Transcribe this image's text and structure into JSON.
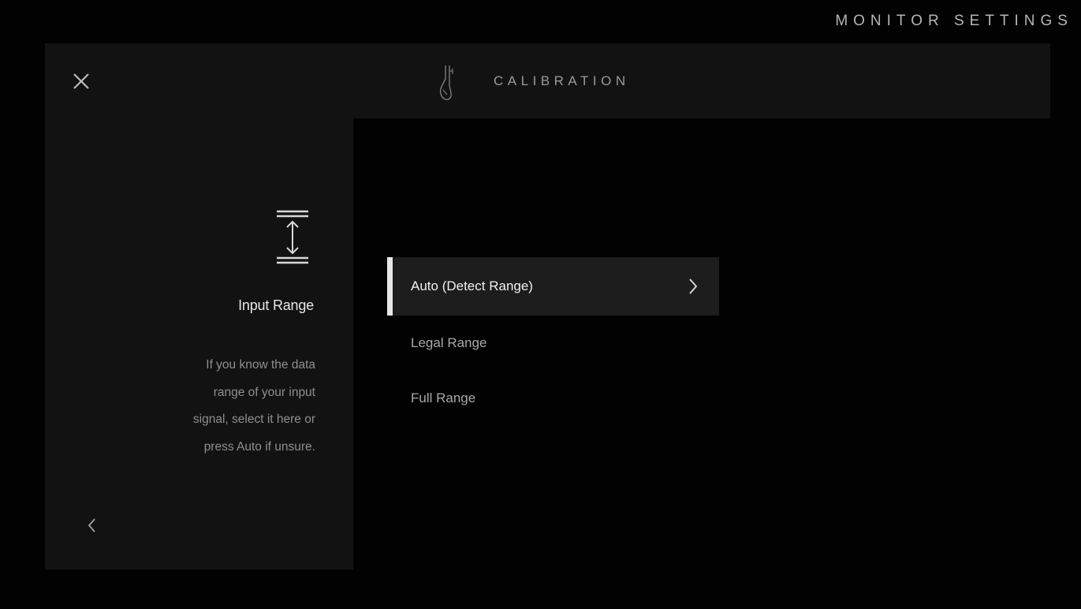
{
  "header": {
    "monitor_title": "MONITOR SETTINGS",
    "section_title": "CALIBRATION",
    "close_icon": "close-icon",
    "section_icon": "calibration-probe-icon"
  },
  "side_panel": {
    "icon": "input-range-icon",
    "heading": "Input Range",
    "description_lines": [
      "If you know the data",
      "range of your input",
      "signal, select it here or",
      "press Auto if unsure."
    ],
    "back_icon": "chevron-left-icon"
  },
  "options": [
    {
      "label": "Auto (Detect Range)",
      "selected": true,
      "has_submenu": true
    },
    {
      "label": "Legal Range",
      "selected": false,
      "has_submenu": false
    },
    {
      "label": "Full Range",
      "selected": false,
      "has_submenu": false
    }
  ],
  "colors": {
    "background": "#020202",
    "panel": "#121212",
    "selected_row": "#1d1d1d",
    "selection_bar": "#e8e8e8"
  }
}
